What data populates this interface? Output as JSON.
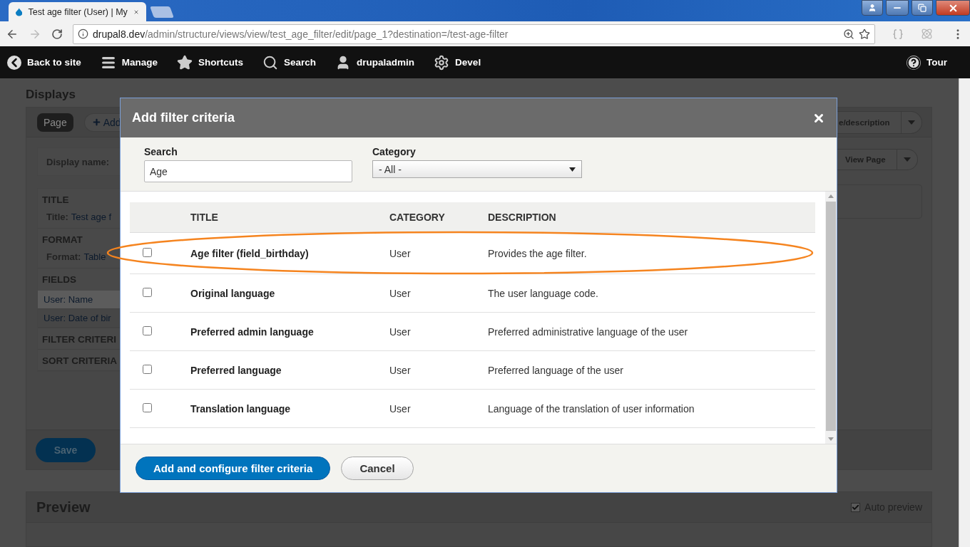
{
  "browser": {
    "tab_title": "Test age filter (User) | My",
    "url_host": "drupal8.dev",
    "url_path": "/admin/structure/views/view/test_age_filter/edit/page_1?destination=/test-age-filter"
  },
  "toolbar": {
    "items": [
      {
        "label": "Back to site"
      },
      {
        "label": "Manage"
      },
      {
        "label": "Shortcuts"
      },
      {
        "label": "Search"
      },
      {
        "label": "drupaladmin"
      },
      {
        "label": "Devel"
      }
    ],
    "right": {
      "label": "Tour"
    }
  },
  "page": {
    "heading": "Displays",
    "display_tab": "Page",
    "add_button": "Add",
    "display_name_label": "Display name:",
    "sections": [
      {
        "heading": "TITLE",
        "rows": [
          {
            "label": "Title:",
            "value": "Test age f"
          }
        ]
      },
      {
        "heading": "FORMAT",
        "rows": [
          {
            "label": "Format:",
            "value": "Table"
          }
        ]
      },
      {
        "heading": "FIELDS",
        "fields": [
          {
            "text": "User: Name",
            "selected": true
          },
          {
            "text": "User: Date of bir",
            "selected": false
          }
        ]
      },
      {
        "heading": "FILTER CRITERI"
      },
      {
        "heading": "SORT CRITERIA"
      }
    ],
    "description_button": "e/description",
    "view_page_button": "View Page",
    "save_button": "Save",
    "preview": {
      "heading": "Preview",
      "auto_preview": {
        "label": "Auto preview",
        "checked": true
      }
    }
  },
  "modal": {
    "title": "Add filter criteria",
    "search": {
      "label": "Search",
      "value": "Age"
    },
    "category": {
      "label": "Category",
      "value": "- All -"
    },
    "columns": [
      "TITLE",
      "CATEGORY",
      "DESCRIPTION"
    ],
    "rows": [
      {
        "title": "Age filter (field_birthday)",
        "category": "User",
        "description": "Provides the age filter.",
        "checked": false,
        "highlighted": true
      },
      {
        "title": "Original language",
        "category": "User",
        "description": "The user language code.",
        "checked": false,
        "highlighted": false
      },
      {
        "title": "Preferred admin language",
        "category": "User",
        "description": "Preferred administrative language of the user",
        "checked": false,
        "highlighted": false
      },
      {
        "title": "Preferred language",
        "category": "User",
        "description": "Preferred language of the user",
        "checked": false,
        "highlighted": false
      },
      {
        "title": "Translation language",
        "category": "User",
        "description": "Language of the translation of user information",
        "checked": false,
        "highlighted": false
      }
    ],
    "primary_button": "Add and configure filter criteria",
    "cancel_button": "Cancel"
  }
}
